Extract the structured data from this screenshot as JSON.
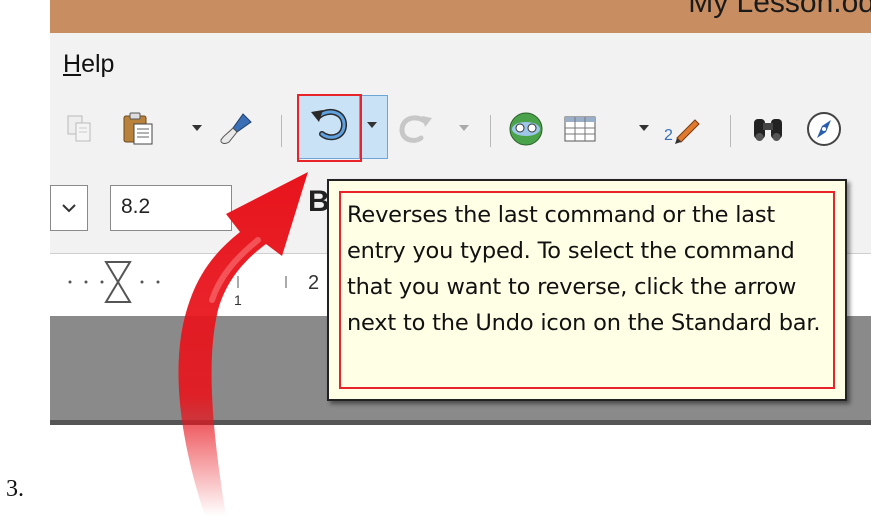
{
  "window": {
    "title": "My Lesson.od"
  },
  "menu": {
    "help_prefix": "H",
    "help_rest": "elp"
  },
  "toolbar": {
    "icons": [
      "copy-icon",
      "paste-icon",
      "clone-formatting-icon",
      "undo-icon",
      "redo-icon",
      "navigator-globe-icon",
      "table-icon",
      "draw-functions-icon",
      "find-replace-icon",
      "navigator-icon"
    ]
  },
  "formatting": {
    "font_size": "8.2",
    "bold_glyph": "B"
  },
  "ruler": {
    "marker": "2",
    "mark_one": "1"
  },
  "tooltip": {
    "text": "Reverses the last command or the last entry you typed. To select the command that you want to reverse, click the arrow next to the Undo icon on the Standard bar."
  },
  "step": {
    "label": "3."
  },
  "colors": {
    "highlight_red": "#e8232a",
    "tooltip_bg": "#ffffe6",
    "undo_highlight": "#c9e2f6",
    "titlebar": "#c88e62"
  }
}
